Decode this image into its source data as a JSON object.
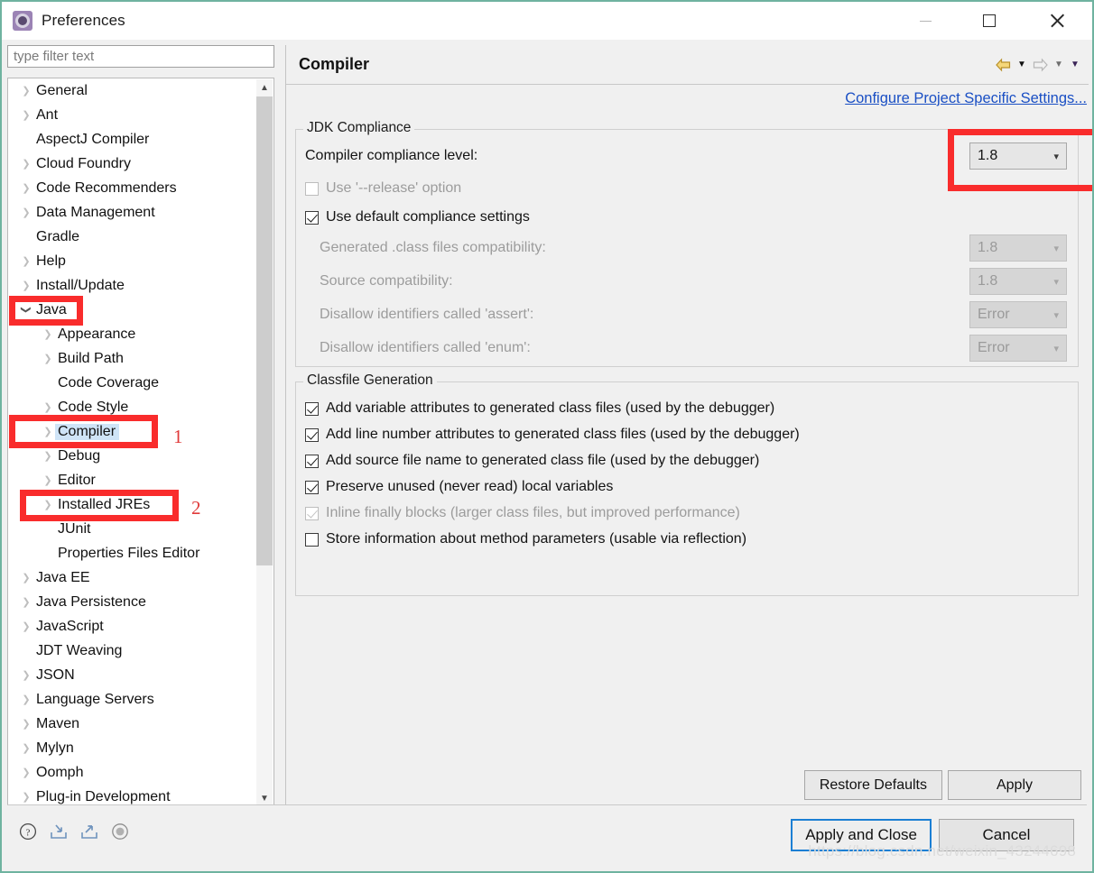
{
  "window": {
    "title": "Preferences",
    "icon": "gear-icon",
    "controls": {
      "minimize": "minimize",
      "maximize": "maximize",
      "close": "close"
    },
    "border_color": "#6fb3a0"
  },
  "filter": {
    "placeholder": "type filter text",
    "value": ""
  },
  "tree": {
    "items": [
      {
        "label": "General",
        "level": 0,
        "arrow": "collapsed",
        "selected": false
      },
      {
        "label": "Ant",
        "level": 0,
        "arrow": "collapsed",
        "selected": false
      },
      {
        "label": "AspectJ Compiler",
        "level": 0,
        "arrow": "none",
        "selected": false
      },
      {
        "label": "Cloud Foundry",
        "level": 0,
        "arrow": "collapsed",
        "selected": false
      },
      {
        "label": "Code Recommenders",
        "level": 0,
        "arrow": "collapsed",
        "selected": false
      },
      {
        "label": "Data Management",
        "level": 0,
        "arrow": "collapsed",
        "selected": false
      },
      {
        "label": "Gradle",
        "level": 0,
        "arrow": "none",
        "selected": false
      },
      {
        "label": "Help",
        "level": 0,
        "arrow": "collapsed",
        "selected": false
      },
      {
        "label": "Install/Update",
        "level": 0,
        "arrow": "collapsed",
        "selected": false
      },
      {
        "label": "Java",
        "level": 0,
        "arrow": "expanded",
        "selected": false
      },
      {
        "label": "Appearance",
        "level": 1,
        "arrow": "collapsed",
        "selected": false
      },
      {
        "label": "Build Path",
        "level": 1,
        "arrow": "collapsed",
        "selected": false
      },
      {
        "label": "Code Coverage",
        "level": 1,
        "arrow": "none",
        "selected": false
      },
      {
        "label": "Code Style",
        "level": 1,
        "arrow": "collapsed",
        "selected": false
      },
      {
        "label": "Compiler",
        "level": 1,
        "arrow": "collapsed",
        "selected": true
      },
      {
        "label": "Debug",
        "level": 1,
        "arrow": "collapsed",
        "selected": false
      },
      {
        "label": "Editor",
        "level": 1,
        "arrow": "collapsed",
        "selected": false
      },
      {
        "label": "Installed JREs",
        "level": 1,
        "arrow": "collapsed",
        "selected": false
      },
      {
        "label": "JUnit",
        "level": 1,
        "arrow": "none",
        "selected": false
      },
      {
        "label": "Properties Files Editor",
        "level": 1,
        "arrow": "none",
        "selected": false
      },
      {
        "label": "Java EE",
        "level": 0,
        "arrow": "collapsed",
        "selected": false
      },
      {
        "label": "Java Persistence",
        "level": 0,
        "arrow": "collapsed",
        "selected": false
      },
      {
        "label": "JavaScript",
        "level": 0,
        "arrow": "collapsed",
        "selected": false
      },
      {
        "label": "JDT Weaving",
        "level": 0,
        "arrow": "none",
        "selected": false
      },
      {
        "label": "JSON",
        "level": 0,
        "arrow": "collapsed",
        "selected": false
      },
      {
        "label": "Language Servers",
        "level": 0,
        "arrow": "collapsed",
        "selected": false
      },
      {
        "label": "Maven",
        "level": 0,
        "arrow": "collapsed",
        "selected": false
      },
      {
        "label": "Mylyn",
        "level": 0,
        "arrow": "collapsed",
        "selected": false
      },
      {
        "label": "Oomph",
        "level": 0,
        "arrow": "collapsed",
        "selected": false
      },
      {
        "label": "Plug-in Development",
        "level": 0,
        "arrow": "collapsed",
        "selected": false
      }
    ]
  },
  "content": {
    "title": "Compiler",
    "configure_link": "Configure Project Specific Settings...",
    "nav": {
      "back_icon": "back-arrow-icon",
      "back_menu_icon": "chevron-down-icon",
      "forward_icon": "forward-arrow-icon",
      "forward_menu_icon": "chevron-down-icon",
      "extra_menu_icon": "chevron-down-icon"
    },
    "jdk_compliance": {
      "title": "JDK Compliance",
      "compliance_level": {
        "label": "Compiler compliance level:",
        "value": "1.8",
        "enabled": true
      },
      "use_release": {
        "label": "Use '--release' option",
        "checked": false,
        "enabled": false
      },
      "use_default": {
        "label": "Use default compliance settings",
        "checked": true,
        "enabled": true
      },
      "fields": [
        {
          "label": "Generated .class files compatibility:",
          "value": "1.8",
          "enabled": false
        },
        {
          "label": "Source compatibility:",
          "value": "1.8",
          "enabled": false
        },
        {
          "label": "Disallow identifiers called 'assert':",
          "value": "Error",
          "enabled": false
        },
        {
          "label": "Disallow identifiers called 'enum':",
          "value": "Error",
          "enabled": false
        }
      ]
    },
    "classfile_generation": {
      "title": "Classfile Generation",
      "options": [
        {
          "label": "Add variable attributes to generated class files (used by the debugger)",
          "checked": true,
          "enabled": true
        },
        {
          "label": "Add line number attributes to generated class files (used by the debugger)",
          "checked": true,
          "enabled": true
        },
        {
          "label": "Add source file name to generated class file (used by the debugger)",
          "checked": true,
          "enabled": true
        },
        {
          "label": "Preserve unused (never read) local variables",
          "checked": true,
          "enabled": true
        },
        {
          "label": "Inline finally blocks (larger class files, but improved performance)",
          "checked": true,
          "enabled": false
        },
        {
          "label": "Store information about method parameters (usable via reflection)",
          "checked": false,
          "enabled": true
        }
      ]
    },
    "buttons": {
      "restore_defaults": "Restore Defaults",
      "apply": "Apply"
    }
  },
  "footer": {
    "icons": [
      {
        "name": "help-icon"
      },
      {
        "name": "import-icon"
      },
      {
        "name": "export-icon"
      },
      {
        "name": "record-icon"
      }
    ],
    "apply_and_close": "Apply and Close",
    "cancel": "Cancel",
    "watermark": "https://blog.csdn.net/weixin_43244698"
  },
  "annotations": {
    "color": "#f92c2c",
    "marker_1": "1",
    "marker_2": "2"
  }
}
